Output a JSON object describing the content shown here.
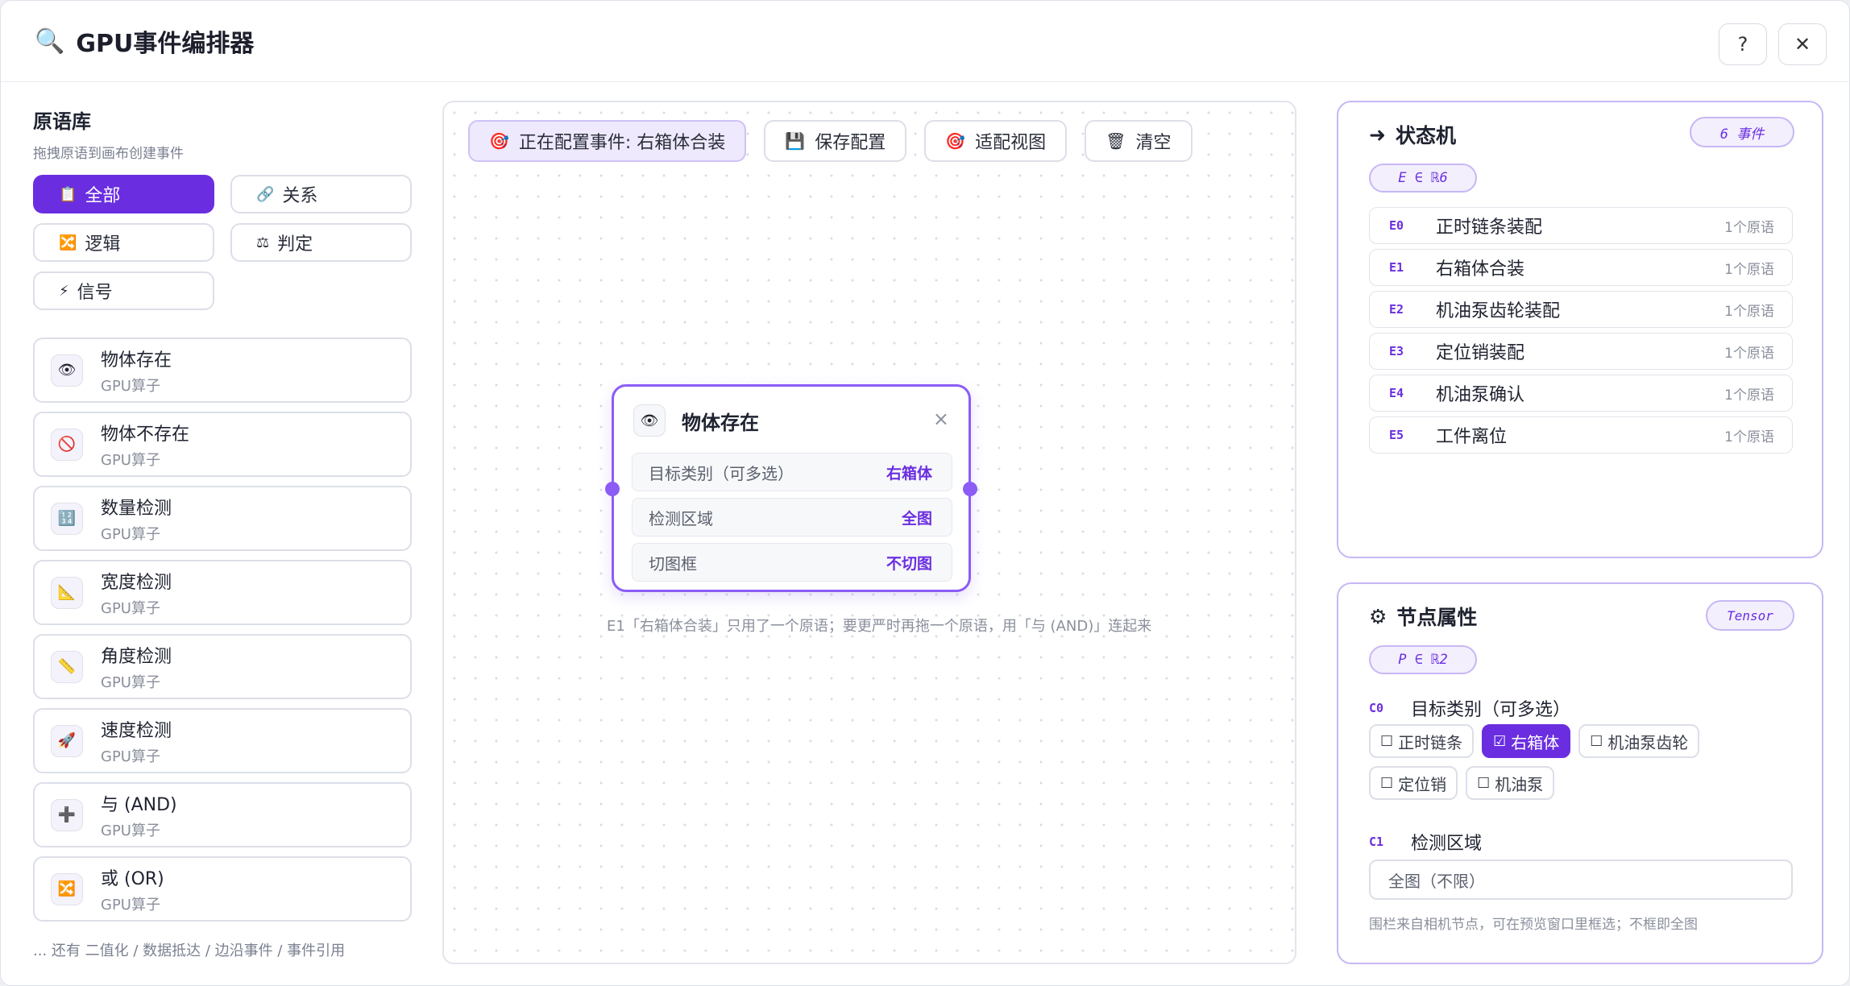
{
  "window": {
    "title": "GPU事件编排器",
    "title_icon": "🔍",
    "help_label": "?",
    "close_label": "✕"
  },
  "library": {
    "title": "原语库",
    "subtitle": "拖拽原语到画布创建事件",
    "filters": [
      {
        "icon": "📋",
        "label": "全部",
        "active": true
      },
      {
        "icon": "🔗",
        "label": "关系",
        "active": false
      },
      {
        "icon": "🔀",
        "label": "逻辑",
        "active": false
      },
      {
        "icon": "⚖",
        "label": "判定",
        "active": false
      },
      {
        "icon": "⚡",
        "label": "信号",
        "active": false
      }
    ],
    "primitives": [
      {
        "icon": "👁",
        "name": "物体存在",
        "type": "GPU算子"
      },
      {
        "icon": "🚫",
        "name": "物体不存在",
        "type": "GPU算子"
      },
      {
        "icon": "🔢",
        "name": "数量检测",
        "type": "GPU算子"
      },
      {
        "icon": "📐",
        "name": "宽度检测",
        "type": "GPU算子"
      },
      {
        "icon": "📏",
        "name": "角度检测",
        "type": "GPU算子"
      },
      {
        "icon": "🚀",
        "name": "速度检测",
        "type": "GPU算子"
      },
      {
        "icon": "➕",
        "name": "与 (AND)",
        "type": "GPU算子"
      },
      {
        "icon": "🔀",
        "name": "或 (OR)",
        "type": "GPU算子"
      }
    ],
    "more": "... 还有 二值化 / 数据抵达 / 边沿事件 / 事件引用"
  },
  "toolbar": {
    "status": {
      "icon": "🎯",
      "label": "正在配置事件: 右箱体合装"
    },
    "save": {
      "icon": "💾",
      "label": "保存配置"
    },
    "fit": {
      "icon": "🎯",
      "label": "适配视图"
    },
    "clear": {
      "icon": "🗑",
      "label": "清空"
    }
  },
  "node": {
    "icon": "👁",
    "title": "物体存在",
    "close": "×",
    "rows": [
      {
        "label": "目标类别（可多选）",
        "value": "右箱体"
      },
      {
        "label": "检测区域",
        "value": "全图"
      },
      {
        "label": "切图框",
        "value": "不切图"
      }
    ]
  },
  "canvas_hint": "E1「右箱体合装」只用了一个原语；要更严时再拖一个原语，用「与 (AND)」连起来",
  "state_machine": {
    "title": "状态机",
    "icon": "➜",
    "badge": "6 事件",
    "formula": "E ∈ ℝ6",
    "events": [
      {
        "id": "E0",
        "name": "正时链条装配",
        "count": "1个原语"
      },
      {
        "id": "E1",
        "name": "右箱体合装",
        "count": "1个原语"
      },
      {
        "id": "E2",
        "name": "机油泵齿轮装配",
        "count": "1个原语"
      },
      {
        "id": "E3",
        "name": "定位销装配",
        "count": "1个原语"
      },
      {
        "id": "E4",
        "name": "机油泵确认",
        "count": "1个原语"
      },
      {
        "id": "E5",
        "name": "工件离位",
        "count": "1个原语"
      }
    ]
  },
  "properties": {
    "title": "节点属性",
    "icon": "⚙",
    "badge": "Tensor",
    "formula": "P ∈ ℝ2",
    "c0": {
      "id": "C0",
      "label": "目标类别（可多选）",
      "options": [
        {
          "label": "正时链条",
          "checked": false
        },
        {
          "label": "右箱体",
          "checked": true
        },
        {
          "label": "机油泵齿轮",
          "checked": false
        },
        {
          "label": "定位销",
          "checked": false
        },
        {
          "label": "机油泵",
          "checked": false
        }
      ]
    },
    "c1": {
      "id": "C1",
      "label": "检测区域",
      "value": "全图（不限）"
    },
    "footnote": "围栏来自相机节点，可在预览窗口里框选；不框即全图"
  },
  "colors": {
    "accent": "#6a2ee0",
    "accent_light": "#8b5cf6",
    "border_soft": "#c7b7f5"
  }
}
